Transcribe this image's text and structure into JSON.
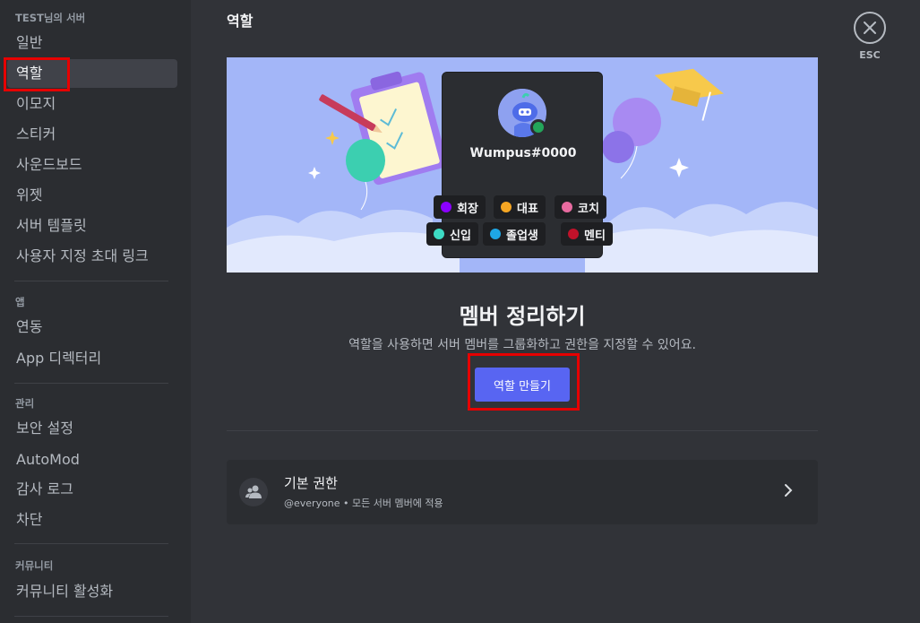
{
  "sidebar": {
    "server_header": "TEST님의 서버",
    "server_items": [
      {
        "label": "일반"
      },
      {
        "label": "역할"
      },
      {
        "label": "이모지"
      },
      {
        "label": "스티커"
      },
      {
        "label": "사운드보드"
      },
      {
        "label": "위젯"
      },
      {
        "label": "서버 템플릿"
      },
      {
        "label": "사용자 지정 초대 링크"
      }
    ],
    "apps_header": "앱",
    "apps_items": [
      {
        "label": "연동"
      },
      {
        "label": "App 디렉터리"
      }
    ],
    "manage_header": "관리",
    "manage_items": [
      {
        "label": "보안 설정"
      },
      {
        "label": "AutoMod"
      },
      {
        "label": "감사 로그"
      },
      {
        "label": "차단"
      }
    ],
    "community_header": "커뮤니티",
    "community_items": [
      {
        "label": "커뮤니티 활성화"
      }
    ],
    "active_item": "역할"
  },
  "header": {
    "title": "역할",
    "esc_label": "ESC"
  },
  "banner": {
    "username": "Wumpus#0000",
    "roles": [
      {
        "name": "회장",
        "color": "#8b00ff"
      },
      {
        "name": "대표",
        "color": "#f5a623"
      },
      {
        "name": "코치",
        "color": "#e86ba0"
      },
      {
        "name": "신입",
        "color": "#3ddbc4"
      },
      {
        "name": "졸업생",
        "color": "#1ea7e6"
      },
      {
        "name": "멘티",
        "color": "#c0122a"
      }
    ]
  },
  "main": {
    "heading": "멤버 정리하기",
    "subtext": "역할을 사용하면 서버 멤버를 그룹화하고 권한을 지정할 수 있어요.",
    "create_button": "역할 만들기",
    "default_perms": {
      "title": "기본 권한",
      "subtitle": "@everyone • 모든 서버 멤버에 적용"
    }
  },
  "colors": {
    "accent": "#5865f2",
    "highlight": "#e60000",
    "banner_bg": "#a3b6f8"
  }
}
